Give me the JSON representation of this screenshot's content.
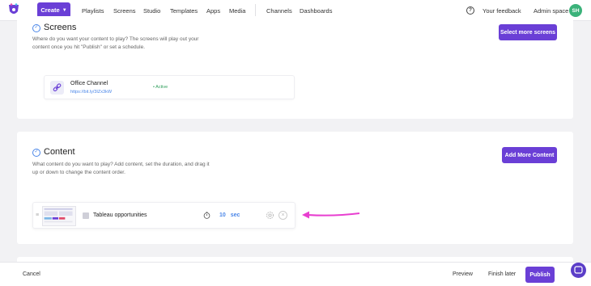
{
  "colors": {
    "accent": "#6a3fd6",
    "link": "#4a86e8",
    "active": "#2e9e5b",
    "annotation_arrow": "#e83fd0"
  },
  "header": {
    "create_label": "Create",
    "nav": [
      "Playlists",
      "Screens",
      "Studio",
      "Templates",
      "Apps",
      "Media"
    ],
    "nav2": [
      "Channels",
      "Dashboards"
    ],
    "feedback": "Your feedback",
    "admin": "Admin space",
    "avatar_initials": "SH"
  },
  "screens_section": {
    "title": "Screens",
    "desc": "Where do you want your content to play? The screens will play out your content once you hit \"Publish\" or set a schedule.",
    "button": "Select more screens",
    "screen": {
      "name": "Office Channel",
      "url": "https://bit.ly/3IZx3kW",
      "status": "• Active"
    }
  },
  "content_section": {
    "title": "Content",
    "desc": "What content do you want to play? Add content, set the duration, and drag it up or down to change the content order.",
    "button": "Add More Content",
    "item": {
      "name": "Tableau opportunities",
      "duration_value": "10",
      "duration_unit": "sec"
    }
  },
  "footer": {
    "cancel": "Cancel",
    "preview": "Preview",
    "finish_later": "Finish later",
    "publish": "Publish"
  }
}
